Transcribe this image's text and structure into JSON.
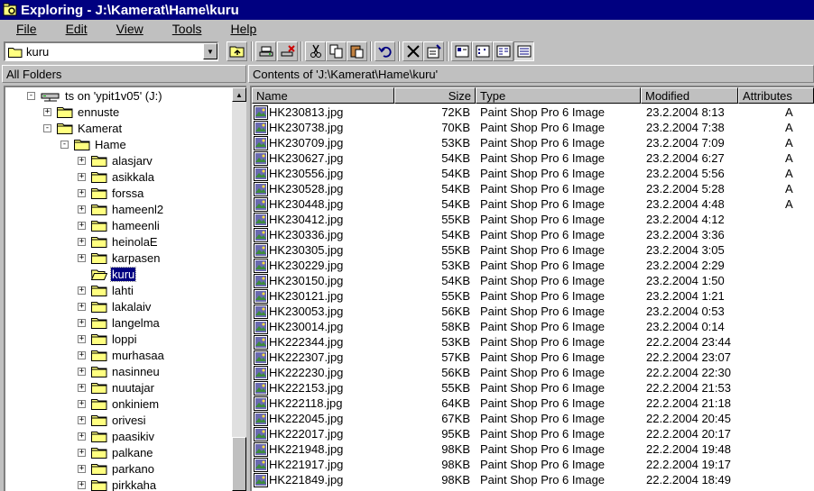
{
  "window": {
    "title": "Exploring - J:\\Kamerat\\Hame\\kuru"
  },
  "menu": [
    "File",
    "Edit",
    "View",
    "Tools",
    "Help"
  ],
  "address": {
    "value": "kuru"
  },
  "panes": {
    "left_header": "All Folders",
    "right_header": "Contents of 'J:\\Kamerat\\Hame\\kuru'"
  },
  "columns": {
    "name": "Name",
    "size": "Size",
    "type": "Type",
    "modified": "Modified",
    "attributes": "Attributes"
  },
  "tree": [
    {
      "label": "ts on 'ypit1v05' (J:)",
      "depth": 0,
      "expander": "-",
      "icon": "network-drive-icon"
    },
    {
      "label": "ennuste",
      "depth": 1,
      "expander": "+",
      "icon": "folder-icon"
    },
    {
      "label": "Kamerat",
      "depth": 1,
      "expander": "-",
      "icon": "folder-icon"
    },
    {
      "label": "Hame",
      "depth": 2,
      "expander": "-",
      "icon": "folder-icon"
    },
    {
      "label": "alasjarv",
      "depth": 3,
      "expander": "+",
      "icon": "folder-icon"
    },
    {
      "label": "asikkala",
      "depth": 3,
      "expander": "+",
      "icon": "folder-icon"
    },
    {
      "label": "forssa",
      "depth": 3,
      "expander": "+",
      "icon": "folder-icon"
    },
    {
      "label": "hameenl2",
      "depth": 3,
      "expander": "+",
      "icon": "folder-icon"
    },
    {
      "label": "hameenli",
      "depth": 3,
      "expander": "+",
      "icon": "folder-icon"
    },
    {
      "label": "heinolaE",
      "depth": 3,
      "expander": "+",
      "icon": "folder-icon"
    },
    {
      "label": "karpasen",
      "depth": 3,
      "expander": "+",
      "icon": "folder-icon"
    },
    {
      "label": "kuru",
      "depth": 3,
      "expander": "",
      "icon": "open-folder-icon",
      "selected": true
    },
    {
      "label": "lahti",
      "depth": 3,
      "expander": "+",
      "icon": "folder-icon"
    },
    {
      "label": "lakalaiv",
      "depth": 3,
      "expander": "+",
      "icon": "folder-icon"
    },
    {
      "label": "langelma",
      "depth": 3,
      "expander": "+",
      "icon": "folder-icon"
    },
    {
      "label": "loppi",
      "depth": 3,
      "expander": "+",
      "icon": "folder-icon"
    },
    {
      "label": "murhasaa",
      "depth": 3,
      "expander": "+",
      "icon": "folder-icon"
    },
    {
      "label": "nasinneu",
      "depth": 3,
      "expander": "+",
      "icon": "folder-icon"
    },
    {
      "label": "nuutajar",
      "depth": 3,
      "expander": "+",
      "icon": "folder-icon"
    },
    {
      "label": "onkiniem",
      "depth": 3,
      "expander": "+",
      "icon": "folder-icon"
    },
    {
      "label": "orivesi",
      "depth": 3,
      "expander": "+",
      "icon": "folder-icon"
    },
    {
      "label": "paasikiv",
      "depth": 3,
      "expander": "+",
      "icon": "folder-icon"
    },
    {
      "label": "palkane",
      "depth": 3,
      "expander": "+",
      "icon": "folder-icon"
    },
    {
      "label": "parkano",
      "depth": 3,
      "expander": "+",
      "icon": "folder-icon"
    },
    {
      "label": "pirkkaha",
      "depth": 3,
      "expander": "+",
      "icon": "folder-icon"
    }
  ],
  "files": [
    {
      "name": "HK230813.jpg",
      "size": "72KB",
      "type": "Paint Shop Pro 6 Image",
      "modified": "23.2.2004 8:13",
      "attributes": "A"
    },
    {
      "name": "HK230738.jpg",
      "size": "70KB",
      "type": "Paint Shop Pro 6 Image",
      "modified": "23.2.2004 7:38",
      "attributes": "A"
    },
    {
      "name": "HK230709.jpg",
      "size": "53KB",
      "type": "Paint Shop Pro 6 Image",
      "modified": "23.2.2004 7:09",
      "attributes": "A"
    },
    {
      "name": "HK230627.jpg",
      "size": "54KB",
      "type": "Paint Shop Pro 6 Image",
      "modified": "23.2.2004 6:27",
      "attributes": "A"
    },
    {
      "name": "HK230556.jpg",
      "size": "54KB",
      "type": "Paint Shop Pro 6 Image",
      "modified": "23.2.2004 5:56",
      "attributes": "A"
    },
    {
      "name": "HK230528.jpg",
      "size": "54KB",
      "type": "Paint Shop Pro 6 Image",
      "modified": "23.2.2004 5:28",
      "attributes": "A"
    },
    {
      "name": "HK230448.jpg",
      "size": "54KB",
      "type": "Paint Shop Pro 6 Image",
      "modified": "23.2.2004 4:48",
      "attributes": "A"
    },
    {
      "name": "HK230412.jpg",
      "size": "55KB",
      "type": "Paint Shop Pro 6 Image",
      "modified": "23.2.2004 4:12",
      "attributes": ""
    },
    {
      "name": "HK230336.jpg",
      "size": "54KB",
      "type": "Paint Shop Pro 6 Image",
      "modified": "23.2.2004 3:36",
      "attributes": ""
    },
    {
      "name": "HK230305.jpg",
      "size": "55KB",
      "type": "Paint Shop Pro 6 Image",
      "modified": "23.2.2004 3:05",
      "attributes": ""
    },
    {
      "name": "HK230229.jpg",
      "size": "53KB",
      "type": "Paint Shop Pro 6 Image",
      "modified": "23.2.2004 2:29",
      "attributes": ""
    },
    {
      "name": "HK230150.jpg",
      "size": "54KB",
      "type": "Paint Shop Pro 6 Image",
      "modified": "23.2.2004 1:50",
      "attributes": ""
    },
    {
      "name": "HK230121.jpg",
      "size": "55KB",
      "type": "Paint Shop Pro 6 Image",
      "modified": "23.2.2004 1:21",
      "attributes": ""
    },
    {
      "name": "HK230053.jpg",
      "size": "56KB",
      "type": "Paint Shop Pro 6 Image",
      "modified": "23.2.2004 0:53",
      "attributes": ""
    },
    {
      "name": "HK230014.jpg",
      "size": "58KB",
      "type": "Paint Shop Pro 6 Image",
      "modified": "23.2.2004 0:14",
      "attributes": ""
    },
    {
      "name": "HK222344.jpg",
      "size": "53KB",
      "type": "Paint Shop Pro 6 Image",
      "modified": "22.2.2004 23:44",
      "attributes": ""
    },
    {
      "name": "HK222307.jpg",
      "size": "57KB",
      "type": "Paint Shop Pro 6 Image",
      "modified": "22.2.2004 23:07",
      "attributes": ""
    },
    {
      "name": "HK222230.jpg",
      "size": "56KB",
      "type": "Paint Shop Pro 6 Image",
      "modified": "22.2.2004 22:30",
      "attributes": ""
    },
    {
      "name": "HK222153.jpg",
      "size": "55KB",
      "type": "Paint Shop Pro 6 Image",
      "modified": "22.2.2004 21:53",
      "attributes": ""
    },
    {
      "name": "HK222118.jpg",
      "size": "64KB",
      "type": "Paint Shop Pro 6 Image",
      "modified": "22.2.2004 21:18",
      "attributes": ""
    },
    {
      "name": "HK222045.jpg",
      "size": "67KB",
      "type": "Paint Shop Pro 6 Image",
      "modified": "22.2.2004 20:45",
      "attributes": ""
    },
    {
      "name": "HK222017.jpg",
      "size": "95KB",
      "type": "Paint Shop Pro 6 Image",
      "modified": "22.2.2004 20:17",
      "attributes": ""
    },
    {
      "name": "HK221948.jpg",
      "size": "98KB",
      "type": "Paint Shop Pro 6 Image",
      "modified": "22.2.2004 19:48",
      "attributes": ""
    },
    {
      "name": "HK221917.jpg",
      "size": "98KB",
      "type": "Paint Shop Pro 6 Image",
      "modified": "22.2.2004 19:17",
      "attributes": ""
    },
    {
      "name": "HK221849.jpg",
      "size": "98KB",
      "type": "Paint Shop Pro 6 Image",
      "modified": "22.2.2004 18:49",
      "attributes": ""
    }
  ],
  "toolbar_icons": [
    "up-folder-icon",
    "map-drive-icon",
    "disconnect-drive-icon",
    "cut-icon",
    "copy-icon",
    "paste-icon",
    "undo-icon",
    "delete-icon",
    "properties-icon",
    "large-icons-view-icon",
    "small-icons-view-icon",
    "list-view-icon",
    "details-view-icon"
  ],
  "colors": {
    "title_bar": "#000080",
    "face": "#c0c0c0",
    "selection": "#000080",
    "folder": "#ffff80"
  }
}
